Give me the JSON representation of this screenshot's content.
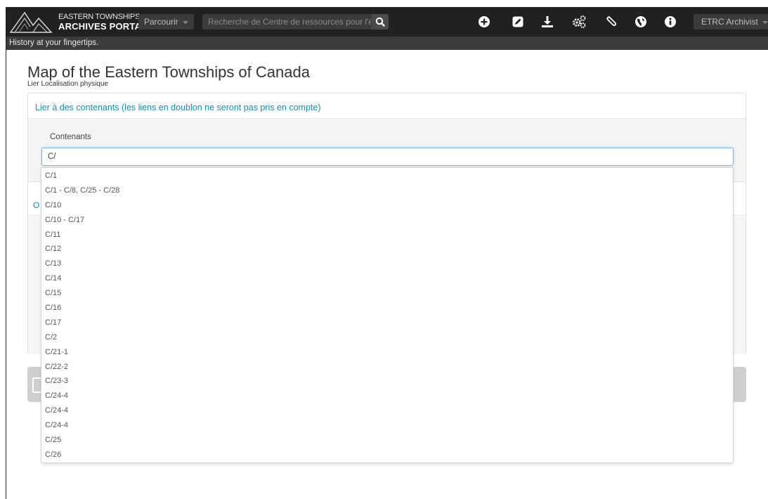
{
  "navbar": {
    "logo_line1": "EASTERN TOWNSHIPS",
    "logo_line2": "ARCHIVES PORTAL",
    "browse_label": "Parcourir",
    "search_placeholder": "Recherche de Centre de ressources pour l'ét",
    "icons": [
      "plus-circle-icon",
      "edit-icon",
      "download-icon",
      "gears-icon",
      "paperclip-icon",
      "globe-icon",
      "info-icon"
    ],
    "user_label": "ETRC Archivist"
  },
  "tagline": "History at your fingertips.",
  "page": {
    "title": "Map of the Eastern Townships of Canada",
    "subtitle": "Lier Localisation physique"
  },
  "panel": {
    "heading": "Lier à des contenants (les liens en doublon ne seront pas pris en compte)",
    "field_label": "Contenants",
    "input_value": "C/",
    "hidden_section_letter": "O"
  },
  "autocomplete": {
    "items": [
      "C/1",
      "C/1 - C/8, C/25 - C/28",
      "C/10",
      "C/10 - C/17",
      "C/11",
      "C/12",
      "C/13",
      "C/14",
      "C/15",
      "C/16",
      "C/17",
      "C/2",
      "C/21-1",
      "C/22-2",
      "C/23-3",
      "C/24-4",
      "C/24-4",
      "C/24-4",
      "C/25",
      "C/26"
    ]
  },
  "colors": {
    "navbar_bg": "#212121",
    "tagline_bg": "#3c3c3c",
    "link_blue": "#1c8bb0",
    "input_focus": "#7fb7dc"
  }
}
